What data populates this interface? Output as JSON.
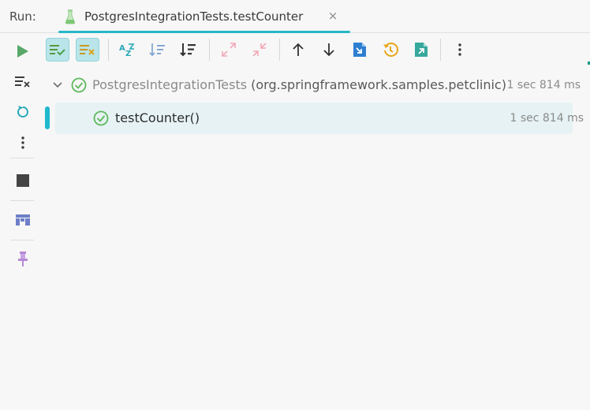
{
  "header": {
    "run_label": "Run:",
    "tab_title": "PostgresIntegrationTests.testCounter",
    "tab_close": "×"
  },
  "toolbar": {
    "show_passed": "show-passed-icon",
    "show_ignored": "show-ignored-icon",
    "sort_alpha": "sort-alphabetically-icon",
    "sort_duration": "sort-by-duration-icon",
    "expand_all": "expand-all-icon",
    "collapse_all": "collapse-all-icon",
    "prev_failed": "arrow-up-icon",
    "next_failed": "arrow-down-icon",
    "import_tests": "import-tests-icon",
    "history": "history-icon",
    "export_tests": "export-tests-icon",
    "more": "more-vertical-icon"
  },
  "tree": {
    "suite": {
      "name": "PostgresIntegrationTests",
      "package": "(org.springframework.samples.petclinic)",
      "duration": "1 sec 814 ms",
      "status": "passed"
    },
    "test": {
      "name": "testCounter()",
      "duration": "1 sec 814 ms",
      "status": "passed"
    }
  },
  "colors": {
    "accent": "#26b7c8",
    "pass": "#5cb85c",
    "run": "#59a869"
  }
}
